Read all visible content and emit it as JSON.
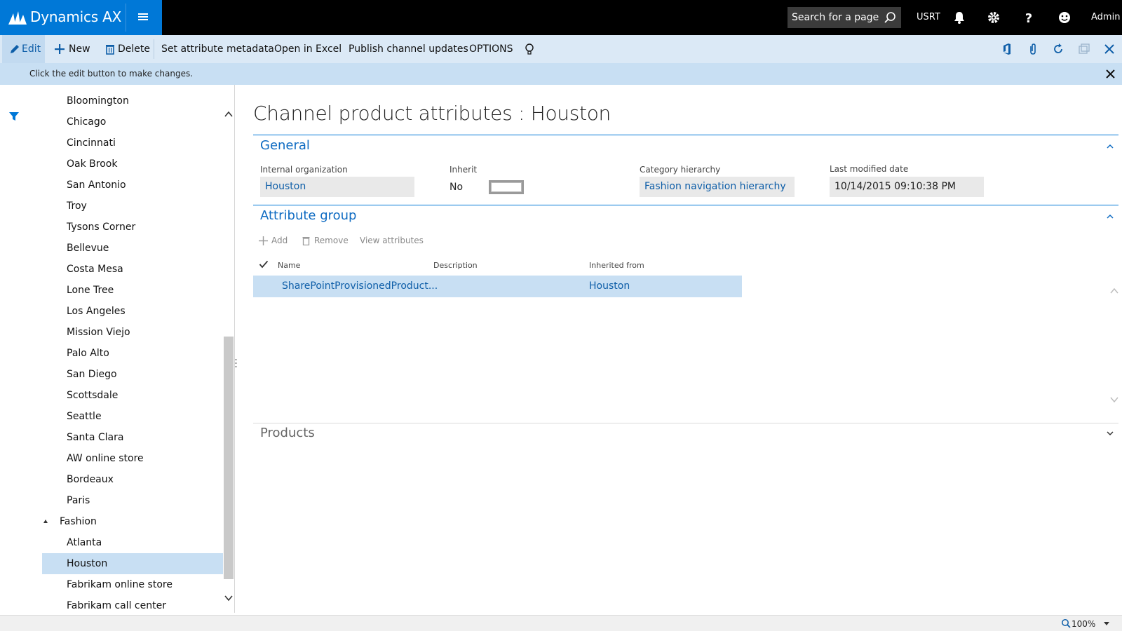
{
  "app": {
    "brand": "Dynamics AX",
    "search_placeholder": "Search for a page",
    "company": "USRT",
    "user": "Admin"
  },
  "actions": {
    "edit": "Edit",
    "new": "New",
    "delete": "Delete",
    "set_attribute_metadata": "Set attribute metadata",
    "open_in_excel": "Open in Excel",
    "publish_channel_updates": "Publish channel updates",
    "options": "OPTIONS"
  },
  "message": "Click the edit button to make changes.",
  "tree": {
    "items": [
      {
        "label": "Bloomington",
        "type": "item"
      },
      {
        "label": "Chicago",
        "type": "item"
      },
      {
        "label": "Cincinnati",
        "type": "item"
      },
      {
        "label": "Oak Brook",
        "type": "item"
      },
      {
        "label": "San Antonio",
        "type": "item"
      },
      {
        "label": "Troy",
        "type": "item"
      },
      {
        "label": "Tysons Corner",
        "type": "item"
      },
      {
        "label": "Bellevue",
        "type": "item"
      },
      {
        "label": "Costa Mesa",
        "type": "item"
      },
      {
        "label": "Lone Tree",
        "type": "item"
      },
      {
        "label": "Los Angeles",
        "type": "item"
      },
      {
        "label": "Mission Viejo",
        "type": "item"
      },
      {
        "label": "Palo Alto",
        "type": "item"
      },
      {
        "label": "San Diego",
        "type": "item"
      },
      {
        "label": "Scottsdale",
        "type": "item"
      },
      {
        "label": "Seattle",
        "type": "item"
      },
      {
        "label": "Santa Clara",
        "type": "item"
      },
      {
        "label": "AW online store",
        "type": "item"
      },
      {
        "label": "Bordeaux",
        "type": "item"
      },
      {
        "label": "Paris",
        "type": "item"
      },
      {
        "label": "Fashion",
        "type": "group"
      },
      {
        "label": "Atlanta",
        "type": "item"
      },
      {
        "label": "Houston",
        "type": "item",
        "selected": true
      },
      {
        "label": "Fabrikam online store",
        "type": "item"
      },
      {
        "label": "Fabrikam call center",
        "type": "item"
      }
    ]
  },
  "page": {
    "title": "Channel product attributes : Houston",
    "general": {
      "title": "General",
      "internal_org_label": "Internal organization",
      "internal_org_value": "Houston",
      "inherit_label": "Inherit",
      "inherit_value": "No",
      "category_label": "Category hierarchy",
      "category_value": "Fashion navigation hierarchy",
      "modified_label": "Last modified date",
      "modified_value": "10/14/2015 09:10:38 PM"
    },
    "attribute_group": {
      "title": "Attribute group",
      "add": "Add",
      "remove": "Remove",
      "view_attributes": "View attributes",
      "columns": [
        "Name",
        "Description",
        "Inherited from"
      ],
      "rows": [
        {
          "name": "SharePointProvisionedProduct...",
          "description": "",
          "inherited_from": "Houston"
        }
      ]
    },
    "products": {
      "title": "Products"
    }
  },
  "status": {
    "zoom": "100%"
  },
  "colors": {
    "brand": "#0078d7",
    "accent_text": "#0e5ea8",
    "selection": "#c8dff3",
    "action_pane": "#dbe9f6"
  }
}
